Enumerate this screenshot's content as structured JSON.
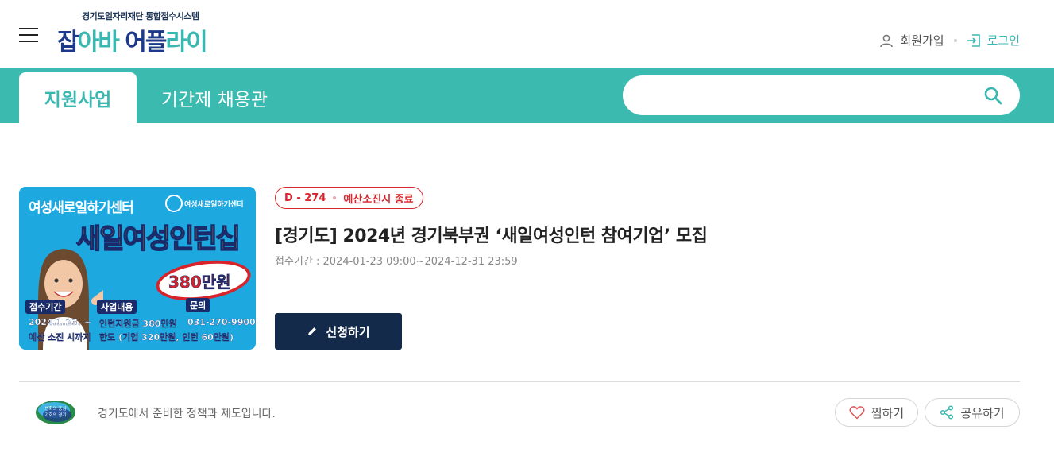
{
  "header": {
    "logo_subtitle": "경기도일자리재단 통합접수시스템",
    "logo_parts": [
      "잡",
      "아바",
      " 어플",
      "라이"
    ],
    "signup_label": "회원가입",
    "login_label": "로그인"
  },
  "nav": {
    "tabs": [
      {
        "label": "지원사업",
        "active": true
      },
      {
        "label": "기간제 채용관",
        "active": false
      }
    ],
    "search": {
      "value": "",
      "placeholder": ""
    }
  },
  "listing": {
    "image": {
      "center_name": "여성새로일하기센터",
      "logo_text": "여성새로일하기센터",
      "headline": "새일여성인턴십",
      "amount": "380만원",
      "labels": [
        "접수기간",
        "사업내용",
        "문의"
      ],
      "period_lines": [
        "2024.1.23. ~",
        "예산 소진 시까지"
      ],
      "content_lines": [
        "인턴지원금 380만원",
        "한도 (기업 320만원, 인턴 60만원)"
      ],
      "contact": "031-270-9900"
    },
    "dday": "D - 274",
    "status": "예산소진시 종료",
    "title": "[경기도] 2024년 경기북부권 ‘새일여성인턴 참여기업’ 모집",
    "period_label": "접수기간 :",
    "period_value": "2024-01-23 09:00~2024-12-31 23:59",
    "apply_label": "신청하기"
  },
  "footer": {
    "logo_lines": [
      "변화의 중심",
      "기회의 경기"
    ],
    "description": "경기도에서 준비한 정책과 제도입니다.",
    "like_label": "찜하기",
    "share_label": "공유하기"
  },
  "colors": {
    "primary_teal": "#3bbab0",
    "navy": "#142a4a",
    "alert_red": "#d9262e"
  },
  "icons": [
    "menu-icon",
    "user-icon",
    "login-icon",
    "search-icon",
    "pencil-icon",
    "heart-icon",
    "share-icon"
  ]
}
